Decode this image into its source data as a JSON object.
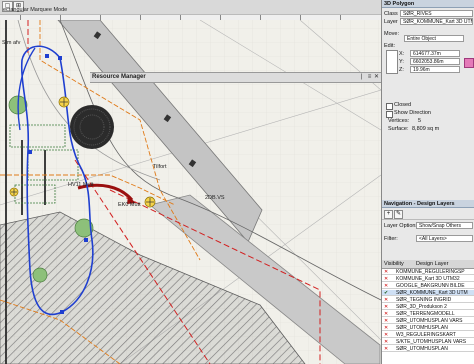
{
  "toolbar": {
    "mode_label": "ectangular Marquee Mode"
  },
  "resource_manager": {
    "title": "Resource Manager",
    "pin": "❘",
    "menu": "≡",
    "close": "✕"
  },
  "drawing": {
    "labels": [
      {
        "text": "Sim afv"
      },
      {
        "text": "HV11 Mutt"
      },
      {
        "text": "EK0 Mutt"
      },
      {
        "text": "Tilfort"
      },
      {
        "text": "2DB.VS"
      }
    ]
  },
  "obj_info": {
    "title": "3D Polygon",
    "class_label": "Class",
    "class_value": "SØR_RIVES",
    "layer_label": "Layer",
    "layer_value": "SØR_KOMMUNE_Kart 3D UTM32 NN",
    "move_label": "Move:",
    "move_value": "Entire Object",
    "edit_label": "Edit:",
    "x_label": "X:",
    "x_value": "614677.37m",
    "y_label": "Y:",
    "y_value": "6602053.86m",
    "z_label": "Z:",
    "z_value": "19.96m",
    "closed_label": "Closed",
    "show_direction_label": "Show Direction",
    "vertices_label": "Vertices:",
    "vertices_value": "5",
    "surface_label": "Surface:",
    "surface_value": "8,809 sq m"
  },
  "navigation": {
    "title": "Navigation - Design Layers",
    "layer_options_label": "Layer Options:",
    "layer_options_value": "Show/Snap Others",
    "filter_label": "Filter:",
    "filter_value": "<All Layers>",
    "col_visibility": "Visibility",
    "col_design_layer": "Design Layer",
    "layers": [
      {
        "name": "KOMMUNE_REGULERINGSP",
        "vis": "✕"
      },
      {
        "name": "KOMMUNE_Kart 3D UTM32",
        "vis": "✕"
      },
      {
        "name": "GOOGLE_BAKGRUNN BILDE",
        "vis": "✕"
      },
      {
        "name": "SØR_KOMMUNE_Kart 3D UTM",
        "vis": "✔"
      },
      {
        "name": "SØR_TEGNING INGRID",
        "vis": "✕"
      },
      {
        "name": "SØR_3D_Produkson 2",
        "vis": "✕"
      },
      {
        "name": "SØR_TERRENGMODELL",
        "vis": "✕"
      },
      {
        "name": "SØR_UTOMHUSPLAN VARS",
        "vis": "✕"
      },
      {
        "name": "SØR_UTOMHUSPLAN",
        "vis": "✕"
      },
      {
        "name": "W3_REGULERINGSKART",
        "vis": "✕"
      },
      {
        "name": "S/KTE_UTOMHUSPLAN VARS",
        "vis": "✕"
      },
      {
        "name": "SØR_UTOMHUSPLAN",
        "vis": "✕"
      }
    ]
  },
  "colors": {
    "selection_red": "#d22020",
    "boundary_orange": "#e07a18",
    "blue_line": "#1f3fd0",
    "road_grey": "#b9b9b9",
    "hatch_grey": "#8a8a8a",
    "panel_header": "#c9d3df"
  }
}
